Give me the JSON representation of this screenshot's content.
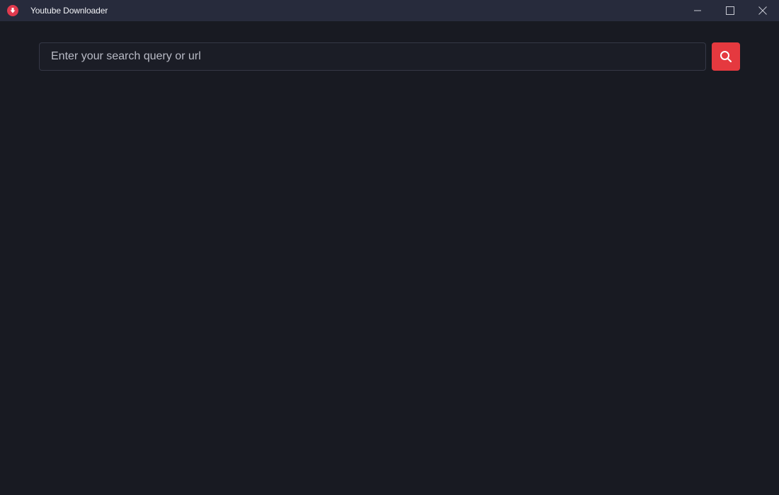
{
  "window": {
    "title": "Youtube Downloader",
    "app_icon": "download-arrow-icon",
    "controls": [
      "minimize-icon",
      "maximize-icon",
      "close-icon"
    ]
  },
  "search": {
    "value": "",
    "placeholder": "Enter your search query or url",
    "button_icon": "search-icon"
  },
  "colors": {
    "background": "#181a22",
    "titlebar": "#272b3c",
    "accent": "#e5393f",
    "app_icon": "#e03a4e"
  }
}
